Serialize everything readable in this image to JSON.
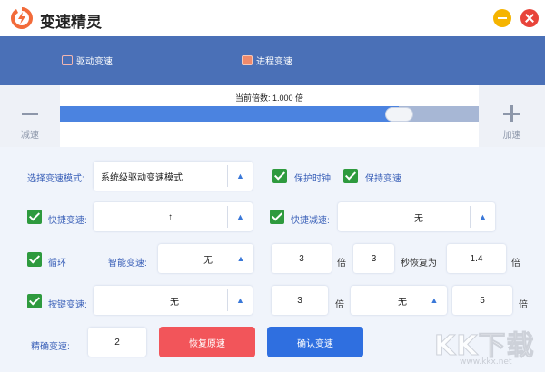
{
  "app": {
    "title": "变速精灵",
    "icon": "lightning-bolt-icon",
    "brand_color": "#f26b3a"
  },
  "tabs": [
    {
      "label": "驱动变速",
      "icon": "drive-icon"
    },
    {
      "label": "进程变速",
      "icon": "process-icon"
    }
  ],
  "speed": {
    "multiplier_text": "当前倍数: 1.000 倍",
    "slower_label": "减速",
    "faster_label": "加速",
    "level": 0.81
  },
  "mode": {
    "label": "选择变速模式:",
    "value": "系统级驱动变速模式",
    "protect_clock_label": "保护时钟",
    "keep_speed_label": "保持变速"
  },
  "hotkeys": {
    "speedup_label": "快捷变速:",
    "speedup_value": "↑",
    "slowdown_label": "快捷减速:",
    "slowdown_value": "无"
  },
  "loop": {
    "label": "循环",
    "smart_label": "智能变速:",
    "smart_value": "无",
    "times": "3",
    "unit_times": "倍",
    "seconds": "3",
    "restore_label": "秒恢复为",
    "restore_value": "1.4",
    "unit_times2": "倍"
  },
  "keyspeed": {
    "label": "按键变速:",
    "key_value": "无",
    "times": "3",
    "unit_times": "倍",
    "key2_value": "无",
    "times2": "5",
    "unit_times2": "倍"
  },
  "precise": {
    "label": "精确变速:",
    "value": "2"
  },
  "buttons": {
    "reset": "恢复原速",
    "confirm": "确认变速"
  },
  "watermark": {
    "text": "KK下载",
    "url": "www.kkx.net"
  }
}
